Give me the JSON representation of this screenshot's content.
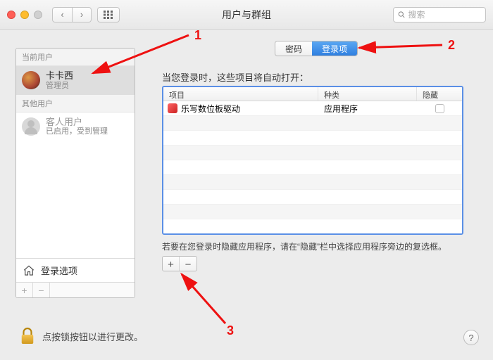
{
  "window": {
    "title": "用户与群组"
  },
  "search": {
    "placeholder": "搜索"
  },
  "sidebar": {
    "current_header": "当前用户",
    "other_header": "其他用户",
    "current": {
      "name": "卡卡西",
      "role": "管理员"
    },
    "guest": {
      "name": "客人用户",
      "status": "已启用，受到管理"
    },
    "login_options": "登录选项"
  },
  "tabs": {
    "password": "密码",
    "login_items": "登录项"
  },
  "right": {
    "description": "当您登录时，这些项目将自动打开：",
    "columns": {
      "item": "项目",
      "kind": "种类",
      "hide": "隐藏"
    },
    "rows": [
      {
        "name": "乐写数位板驱动",
        "kind": "应用程序"
      }
    ],
    "hint": "若要在您登录时隐藏应用程序，请在“隐藏”栏中选择应用程序旁边的复选框。"
  },
  "lock": {
    "text": "点按锁按钮以进行更改。"
  },
  "annotations": {
    "n1": "1",
    "n2": "2",
    "n3": "3"
  }
}
